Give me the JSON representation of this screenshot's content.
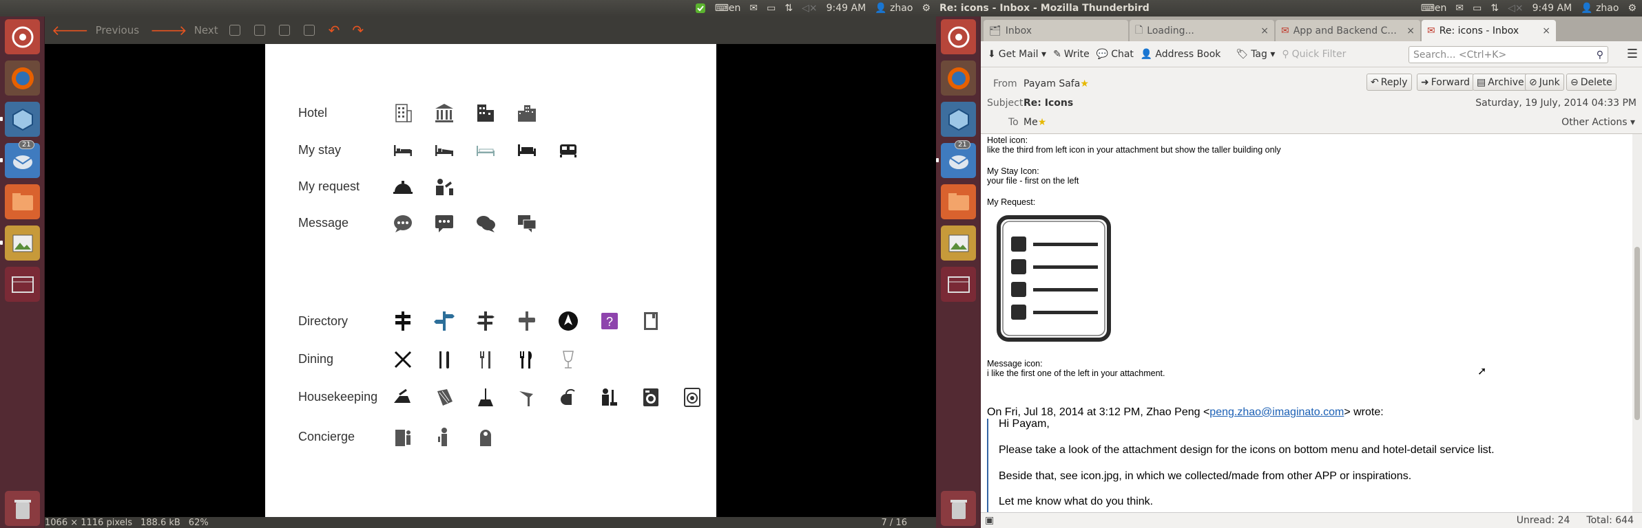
{
  "screen1": {
    "topbar": {
      "lang": "en",
      "time": "9:49 AM",
      "user": "zhao",
      "title": ""
    },
    "toolbar": {
      "previous": "Previous",
      "next": "Next"
    },
    "doc": {
      "labels": [
        "Hotel",
        "My stay",
        "My request",
        "Message",
        "Directory",
        "Dining",
        "Housekeeping",
        "Concierge"
      ]
    },
    "status": {
      "dimensions": "1066 × 1116 pixels",
      "size": "188.6 kB",
      "zoom": "62%",
      "page": "7 / 16"
    }
  },
  "screen2": {
    "topbar": {
      "lang": "en",
      "time": "9:49 AM",
      "user": "zhao",
      "title": "Re: icons - Inbox - Mozilla Thunderbird"
    },
    "launcher_badge": "21",
    "tabs": [
      {
        "label": "Inbox"
      },
      {
        "label": "Loading..."
      },
      {
        "label": "App and Backend C..."
      },
      {
        "label": "Re: icons - Inbox"
      }
    ],
    "toolbar": {
      "get_mail": "Get Mail",
      "write": "Write",
      "chat": "Chat",
      "address_book": "Address Book",
      "tag": "Tag",
      "quick_filter": "Quick Filter",
      "search_placeholder": "Search... <Ctrl+K>"
    },
    "header": {
      "from_label": "From",
      "from_value": "Payam Safa",
      "subject_label": "Subject",
      "subject_value": "Re: Icons",
      "to_label": "To",
      "to_value": "Me",
      "date": "Saturday, 19 July, 2014 04:33 PM",
      "other_actions": "Other Actions",
      "buttons": {
        "reply": "Reply",
        "forward": "Forward",
        "archive": "Archive",
        "junk": "Junk",
        "delete": "Delete"
      }
    },
    "body": {
      "hotel_label": "Hotel icon:",
      "hotel_text": "like the third from left icon in your attachment but show the taller building only",
      "stay_label": "My Stay Icon:",
      "stay_text": "your file - first on the left",
      "request_label": "My Request:",
      "message_label": "Message icon:",
      "message_text": "i like the first one of the left in your attachment.",
      "quote_intro": "On Fri, Jul 18, 2014 at 3:12 PM, Zhao Peng <",
      "quote_email": "peng.zhao@imaginato.com",
      "quote_wrote": "> wrote:",
      "q1": "Hi Payam,",
      "q2": "Please take a look of the attachment design for the icons on bottom menu and hotel-detail service list.",
      "q3": "Beside that, see icon.jpg, in which we collected/made from other APP or inspirations.",
      "q4": "Let me know what do you think."
    },
    "status": {
      "unread": "Unread: 24",
      "total": "Total: 644"
    }
  },
  "colors": {
    "launcher": "#532a33",
    "panel": "#3c3b37",
    "orange_arrow": "#e95420",
    "link": "#1a5fb4"
  }
}
